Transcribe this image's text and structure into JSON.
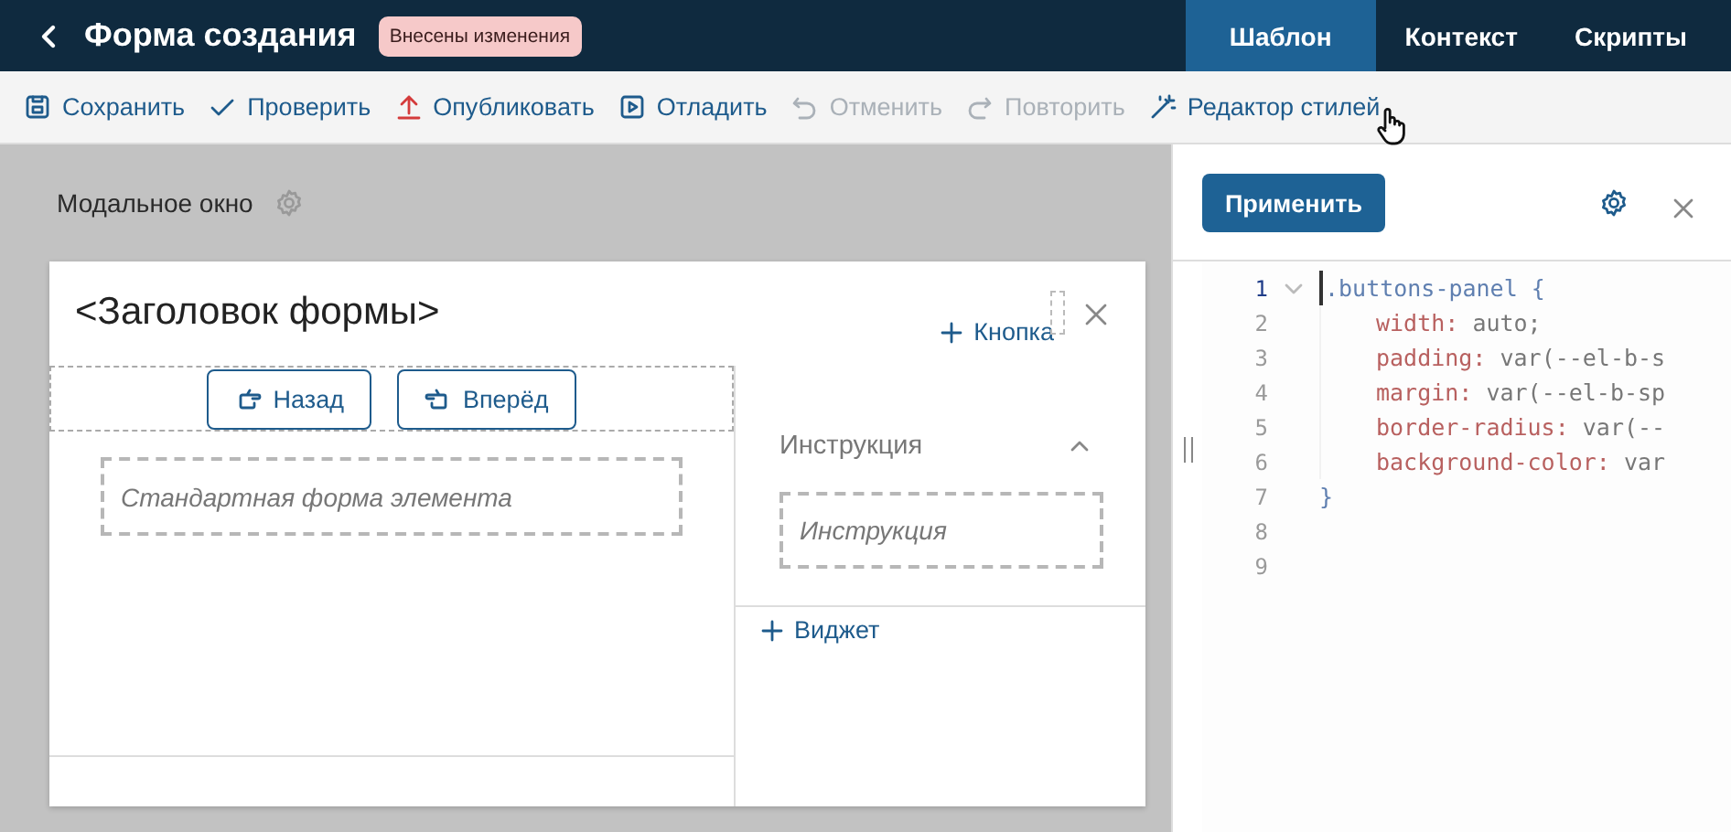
{
  "header": {
    "title": "Форма создания",
    "badge": "Внесены изменения"
  },
  "tabs": [
    {
      "label": "Шаблон",
      "selected": true
    },
    {
      "label": "Контекст",
      "selected": false
    },
    {
      "label": "Скрипты",
      "selected": false
    }
  ],
  "toolbar": [
    {
      "label": "Сохранить",
      "disabled": false
    },
    {
      "label": "Проверить",
      "disabled": false
    },
    {
      "label": "Опубликовать",
      "disabled": false
    },
    {
      "label": "Отладить",
      "disabled": false
    },
    {
      "label": "Отменить",
      "disabled": true
    },
    {
      "label": "Повторить",
      "disabled": true
    },
    {
      "label": "Редактор стилей",
      "disabled": false
    }
  ],
  "canvas": {
    "label": "Модальное окно",
    "form": {
      "title": "<Заголовок формы>",
      "add_button": "Кнопка",
      "buttons": [
        "Назад",
        "Вперёд"
      ],
      "field": "Стандартная форма элемента",
      "side": {
        "heading": "Инструкция",
        "expanded": true,
        "field": "Инструкция",
        "add_widget": "Виджет"
      }
    }
  },
  "editor": {
    "apply": "Применить",
    "lines": [
      {
        "number": "1",
        "kind": "selector",
        "text": ".buttons-panel {",
        "selected": true
      },
      {
        "number": "2",
        "kind": "declaration",
        "property": "width:",
        "value": "auto;",
        "selected": false
      },
      {
        "number": "3",
        "kind": "declaration",
        "property": "padding:",
        "value": "var(--el-b-s",
        "selected": false
      },
      {
        "number": "4",
        "kind": "declaration",
        "property": "margin:",
        "value": "var(--el-b-sp",
        "selected": false
      },
      {
        "number": "5",
        "kind": "declaration",
        "property": "border-radius:",
        "value": "var(--",
        "selected": false
      },
      {
        "number": "6",
        "kind": "declaration",
        "property": "background-color:",
        "value": "var",
        "selected": false
      },
      {
        "number": "7",
        "kind": "brace",
        "text": "}",
        "selected": false
      },
      {
        "number": "8",
        "kind": "empty",
        "selected": false
      },
      {
        "number": "9",
        "kind": "empty",
        "selected": false
      }
    ]
  }
}
